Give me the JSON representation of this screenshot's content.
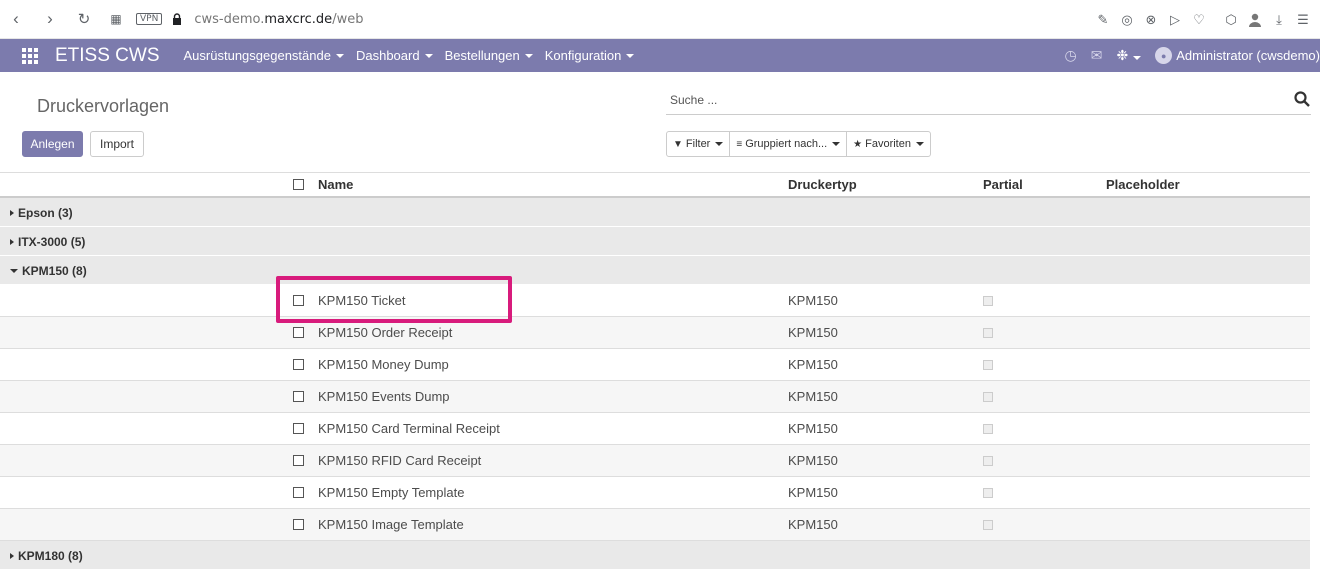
{
  "browser": {
    "vpn_label": "VPN",
    "url_prefix": "cws-demo.",
    "url_domain": "maxcrc.de",
    "url_path": "/web"
  },
  "navbar": {
    "brand": "ETISS CWS",
    "menu": [
      {
        "label": "Ausrüstungsgegenstände"
      },
      {
        "label": "Dashboard"
      },
      {
        "label": "Bestellungen"
      },
      {
        "label": "Konfiguration"
      }
    ],
    "user": "Administrator (cwsdemo)"
  },
  "control_panel": {
    "breadcrumb": "Druckervorlagen",
    "create_label": "Anlegen",
    "import_label": "Import",
    "search_placeholder": "Suche ...",
    "filter_label": "Filter",
    "groupby_label": "Gruppiert nach...",
    "favorites_label": "Favoriten"
  },
  "table": {
    "columns": {
      "name": "Name",
      "printer_type": "Druckertyp",
      "partial": "Partial",
      "placeholder": "Placeholder"
    },
    "groups": [
      {
        "label": "Epson (3)",
        "expanded": false
      },
      {
        "label": "ITX-3000 (5)",
        "expanded": false
      },
      {
        "label": "KPM150 (8)",
        "expanded": true
      },
      {
        "label": "KPM180 (8)",
        "expanded": false
      }
    ],
    "rows": [
      {
        "name": "KPM150 Ticket",
        "type": "KPM150"
      },
      {
        "name": "KPM150 Order Receipt",
        "type": "KPM150"
      },
      {
        "name": "KPM150 Money Dump",
        "type": "KPM150"
      },
      {
        "name": "KPM150 Events Dump",
        "type": "KPM150"
      },
      {
        "name": "KPM150 Card Terminal Receipt",
        "type": "KPM150"
      },
      {
        "name": "KPM150 RFID Card Receipt",
        "type": "KPM150"
      },
      {
        "name": "KPM150 Empty Template",
        "type": "KPM150"
      },
      {
        "name": "KPM150 Image Template",
        "type": "KPM150"
      }
    ]
  },
  "colors": {
    "navbar": "#7c7bad",
    "highlight": "#d81b7c",
    "group_bg": "#e9e9e9"
  }
}
